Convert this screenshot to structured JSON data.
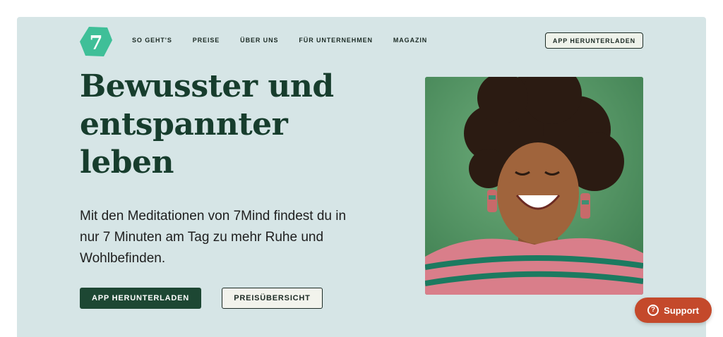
{
  "brand": {
    "logo_text": "7",
    "logo_color": "#3fbf98"
  },
  "nav": {
    "items": [
      {
        "label": "SO GEHT'S"
      },
      {
        "label": "PREISE"
      },
      {
        "label": "ÜBER UNS"
      },
      {
        "label": "FÜR UNTERNEHMEN"
      },
      {
        "label": "MAGAZIN"
      }
    ],
    "cta_label": "APP HERUNTERLADEN"
  },
  "hero": {
    "headline": "Bewusster und entspannter leben",
    "subtext": "Mit den Meditationen von 7Mind findest du in nur 7 Minuten am Tag zu mehr Ruhe und Wohlbefinden.",
    "primary_button": "APP HERUNTERLADEN",
    "secondary_button": "PREISÜBERSICHT"
  },
  "support": {
    "icon": "question-circle-icon",
    "label": "Support"
  },
  "colors": {
    "hero_bg": "#d6e5e6",
    "headline": "#173d2d",
    "primary_button": "#1d4733",
    "support_button": "#c4492b"
  }
}
